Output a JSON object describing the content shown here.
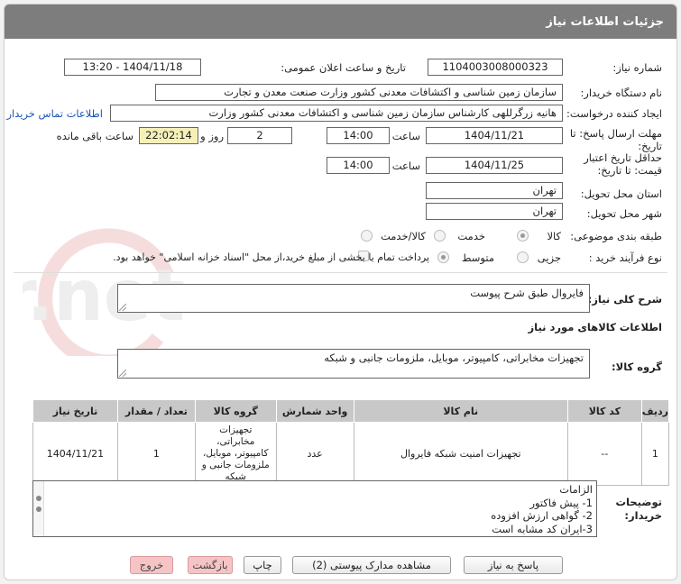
{
  "header": {
    "title": "جزئیات اطلاعات نیاز"
  },
  "fields": {
    "need_number": {
      "label": "شماره نیاز:",
      "value": "1104003008000323"
    },
    "announce_datetime": {
      "label": "تاریخ و ساعت اعلان عمومی:",
      "value": "1404/11/18 - 13:20"
    },
    "buyer_org": {
      "label": "نام دستگاه خریدار:",
      "value": "سازمان زمین شناسی و اکتشافات معدنی کشور وزارت صنعت معدن و تجارت"
    },
    "requester": {
      "label": "ایجاد کننده درخواست:",
      "value": "هانیه زرگرللهی کارشناس سازمان زمین شناسی و اکتشافات معدنی کشور وزارت",
      "contact_link": "اطلاعات تماس خریدار"
    },
    "reply_deadline": {
      "label_line1": "مهلت ارسال پاسخ: تا",
      "label_line2": "تاریخ:",
      "date": "1404/11/21",
      "time_label": "ساعت",
      "time": "14:00",
      "days": "2",
      "days_label": "روز و",
      "remaining": "22:02:14",
      "remaining_label": "ساعت باقی مانده"
    },
    "price_validity": {
      "label_line1": "حداقل تاریخ اعتبار",
      "label_line2": "قیمت: تا تاریخ:",
      "date": "1404/11/25",
      "time_label": "ساعت",
      "time": "14:00"
    },
    "delivery_province": {
      "label": "استان محل تحویل:",
      "value": "تهران"
    },
    "delivery_city": {
      "label": "شهر محل تحویل:",
      "value": "تهران"
    },
    "category": {
      "label": "طبقه بندی موضوعی:",
      "options": [
        "کالا",
        "خدمت",
        "کالا/خدمت"
      ],
      "selected": "کالا"
    },
    "purchase_type": {
      "label": "نوع فرآیند خرید :",
      "options": [
        "جزیی",
        "متوسط"
      ],
      "selected": "جزیی",
      "treasury_note": "پرداخت تمام یا بخشی از مبلغ خرید،از محل \"اسناد خزانه اسلامی\" خواهد بود."
    }
  },
  "summary": {
    "label": "شرح کلی نیاز:",
    "value": "فایروال طبق شرح پیوست"
  },
  "goods_info": {
    "title": "اطلاعات کالاهای مورد نیاز",
    "group_label": "گروه کالا:",
    "group_value": "تجهیزات مخابراتی، کامپیوتر، موبایل، ملزومات جانبی و شبکه"
  },
  "table": {
    "columns": [
      "ردیف",
      "کد کالا",
      "نام کالا",
      "واحد شمارش",
      "گروه کالا",
      "تعداد / مقدار",
      "تاریخ نیاز"
    ],
    "rows": [
      {
        "row": "1",
        "code": "--",
        "name": "تجهیزات امنیت شبکه فایروال",
        "unit": "عدد",
        "group": "تجهیزات مخابراتی، کامپیوتر، موبایل، ملزومات جانبی و شبکه",
        "qty": "1",
        "date": "1404/11/21"
      }
    ]
  },
  "buyer_notes": {
    "label_line1": "توضیحات",
    "label_line2": "خریدار:",
    "lines": [
      "الزامات",
      "1-  پیش فاکتور",
      "2- گواهی ارزش افزوده",
      "3-ایران کد مشابه است"
    ]
  },
  "buttons": {
    "reply": "پاسخ به نیاز",
    "attachments": "مشاهده مدارک پیوستی (2)",
    "print": "چاپ",
    "back": "بازگشت",
    "exit": "خروج"
  },
  "watermark_text": "AriaTender.net",
  "colors": {
    "header_bg": "#7d7d7d",
    "time_highlight": "#f5f0b8",
    "link": "#1a55b5",
    "danger_button": "#f6c4c4"
  }
}
